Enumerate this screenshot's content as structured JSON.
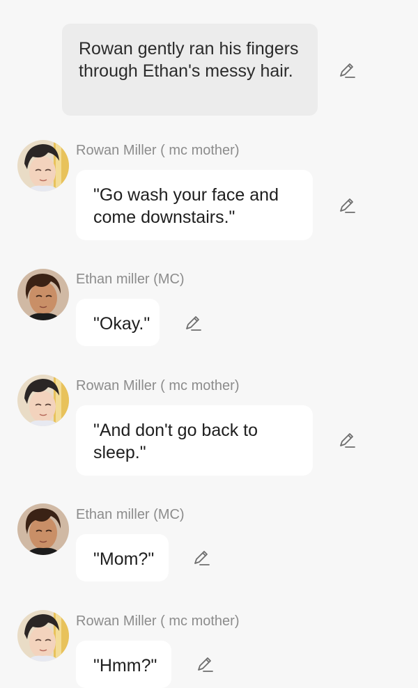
{
  "narration": {
    "text": "Rowan gently ran his fingers through Ethan's messy hair."
  },
  "messages": [
    {
      "name": "Rowan Miller ( mc mother)",
      "text": "\"Go wash your face and come downstairs.\""
    },
    {
      "name": "Ethan miller (MC)",
      "text": "\"Okay.\""
    },
    {
      "name": "Rowan Miller ( mc mother)",
      "text": "\"And don't go back to sleep.\""
    },
    {
      "name": "Ethan miller (MC)",
      "text": "\"Mom?\""
    },
    {
      "name": "Rowan Miller ( mc mother)",
      "text": "\"Hmm?\""
    }
  ],
  "icons": {
    "edit": "pencil-edit-icon",
    "avatar_rowan": "rowan-avatar",
    "avatar_ethan": "ethan-avatar"
  },
  "colors": {
    "background": "#f7f7f7",
    "bubble": "#ffffff",
    "narration_bubble": "#ececec",
    "name_text": "#8c8c8c"
  }
}
